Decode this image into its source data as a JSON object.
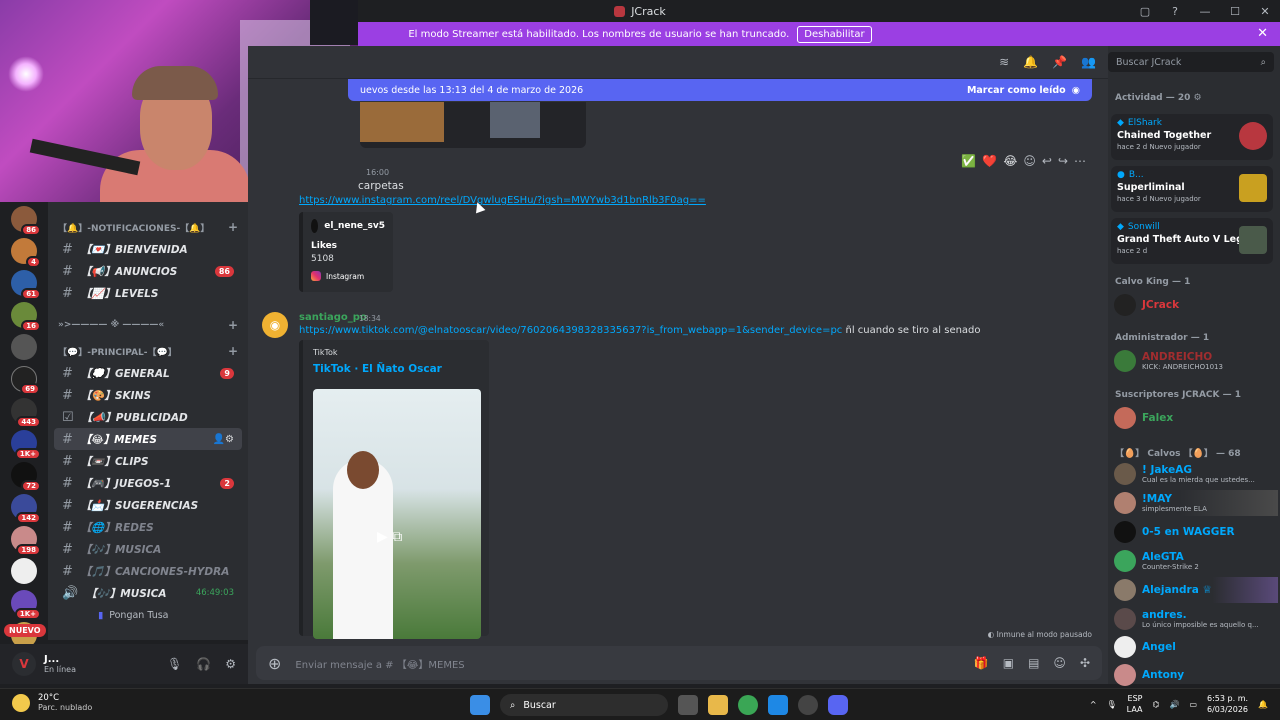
{
  "window": {
    "title": "JCrack",
    "controls": [
      "▢",
      "?",
      "—",
      "☐",
      "✕"
    ]
  },
  "banner": {
    "text": "El modo Streamer está habilitado. Los nombres de usuario se han truncado.",
    "button": "Deshabilitar"
  },
  "server_badges": [
    "86",
    "4",
    "61",
    "16",
    "",
    "69",
    "443",
    "1K+",
    "72",
    "142",
    "198",
    "",
    "1K+",
    ""
  ],
  "new_label": "NUEVO",
  "categories": {
    "notifications": "【🔔】-NOTIFICACIONES-【🔔】",
    "separator": "»>————  ※  ————«",
    "principal": "【💬】-PRINCIPAL-【💬】"
  },
  "channels": [
    {
      "label": "【💌】BIENVENIDA"
    },
    {
      "label": "【📢】ANUNCIOS",
      "count": "86"
    },
    {
      "label": "【📈】LEVELS"
    },
    {
      "label": "【💭】GENERAL",
      "count": "9"
    },
    {
      "label": "【🎨】SKINS"
    },
    {
      "label": "【📣】PUBLICIDAD"
    },
    {
      "label": "【😂】MEMES"
    },
    {
      "label": "【📼】CLIPS"
    },
    {
      "label": "【🎮】JUEGOS-1",
      "count": "2"
    },
    {
      "label": "【📩】SUGERENCIAS"
    },
    {
      "label": "【🌐】REDES"
    },
    {
      "label": "【🎶】MUSICA"
    },
    {
      "label": "【🎵】CANCIONES-HYDRA"
    },
    {
      "label": "【🎶】MUSICA",
      "time": "46:49:03"
    }
  ],
  "voice_user": "Pongan Tusa",
  "user_panel": {
    "name": "J...",
    "status": "En línea"
  },
  "new_messages_bar": {
    "text": "uevos desde las 13:13 del 4 de marzo de 2026",
    "action": "Marcar como leído"
  },
  "reactions": [
    "✅",
    "❤️",
    "😂"
  ],
  "message1": {
    "time": "16:00",
    "text": "carpetas",
    "link": "https://www.instagram.com/reel/DVgwlugESHu/?igsh=MWYwb3d1bnRlb3F0ag=="
  },
  "embed1": {
    "author": "el_nene_sv5",
    "title": "Likes",
    "value": "5108",
    "footer": "Instagram"
  },
  "message2": {
    "author": "santiago_po",
    "time": "18:34",
    "link": "https://www.tiktok.com/@elnatooscar/video/7602064398328335637?is_from_webapp=1&sender_device=pc",
    "text": " ñl cuando se tiro al senado"
  },
  "embed2": {
    "provider": "TikTok",
    "title": "TikTok · El Ñato Oscar"
  },
  "immune_label": "Inmune al modo pausado",
  "composer": {
    "placeholder": "Enviar mensaje a # 【😂】MEMES"
  },
  "search": {
    "placeholder": "Buscar JCrack"
  },
  "activity": {
    "header": "Actividad — 20",
    "items": [
      {
        "user": "ElShark",
        "game": "Chained Together",
        "meta": "hace 2 d   Nuevo jugador"
      },
      {
        "user": "B...",
        "game": "Superliminal",
        "meta": "hace 3 d   Nuevo jugador"
      },
      {
        "user": "Sonwill",
        "game": "Grand Theft Auto V Legacy",
        "meta": "hace 2 d"
      }
    ]
  },
  "groups": [
    {
      "header": "Calvo King — 1",
      "members": [
        {
          "name": "JCrack",
          "color": "#da373c",
          "sub": ""
        }
      ]
    },
    {
      "header": "Administrador — 1",
      "members": [
        {
          "name": "ANDREICHO",
          "color": "#a12d2f",
          "sub": "KICK: ANDREICHO1013"
        }
      ]
    },
    {
      "header": "Suscriptores JCRACK — 1",
      "members": [
        {
          "name": "Falex",
          "color": "#3ba55c",
          "sub": ""
        }
      ]
    },
    {
      "header": "【🥚】 Calvos 【🥚】 — 68",
      "members": [
        {
          "name": "! JakeAG",
          "color": "#00a8fc",
          "sub": "Cual es la mierda que ustedes..."
        },
        {
          "name": "!MAY",
          "color": "#00a8fc",
          "sub": "simplesmente ELA"
        },
        {
          "name": "0-5 en WAGGER",
          "color": "#00a8fc",
          "sub": ""
        },
        {
          "name": "AleGTA",
          "color": "#00a8fc",
          "sub": "Counter-Strike 2"
        },
        {
          "name": "Alejandra ♕",
          "color": "#00a8fc",
          "sub": ""
        },
        {
          "name": "andres.",
          "color": "#00a8fc",
          "sub": "Lo único imposible es aquello q..."
        },
        {
          "name": "Angel",
          "color": "#00a8fc",
          "sub": ""
        },
        {
          "name": "Antony",
          "color": "#00a8fc",
          "sub": ""
        }
      ]
    }
  ],
  "taskbar": {
    "temp": "20°C",
    "weather": "Parc. nublado",
    "search": "Buscar",
    "lang1": "ESP",
    "lang2": "LAA",
    "time": "6:53 p. m.",
    "date": "6/03/2026"
  },
  "colors": {
    "accent": "#5865f2",
    "streamer": "#9b3fe3",
    "link": "#00a8fc",
    "danger": "#da373c"
  }
}
